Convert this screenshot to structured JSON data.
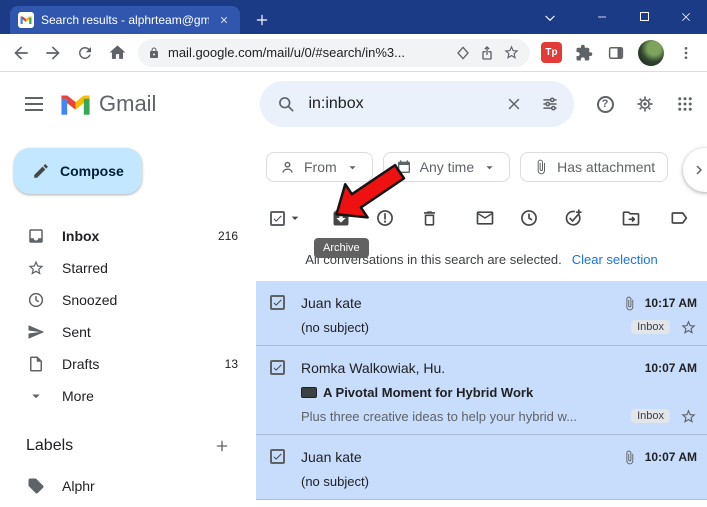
{
  "browser": {
    "tab_title": "Search results - alphrteam@gma",
    "url": "mail.google.com/mail/u/0/#search/in%3...",
    "extension_badge": "Tp"
  },
  "gmail": {
    "logo_text": "Gmail",
    "search_query": "in:inbox",
    "compose_label": "Compose",
    "nav": [
      {
        "label": "Inbox",
        "count": "216"
      },
      {
        "label": "Starred",
        "count": ""
      },
      {
        "label": "Snoozed",
        "count": ""
      },
      {
        "label": "Sent",
        "count": ""
      },
      {
        "label": "Drafts",
        "count": "13"
      },
      {
        "label": "More",
        "count": ""
      }
    ],
    "labels_header": "Labels",
    "label_items": [
      {
        "name": "Alphr"
      }
    ],
    "chips": {
      "from": "From",
      "any_time": "Any time",
      "has_attachment": "Has attachment"
    },
    "tooltip_archive": "Archive",
    "banner": {
      "text": "All conversations in this search are selected.",
      "action": "Clear selection"
    },
    "emails": [
      {
        "sender": "Juan kate",
        "subject": "(no subject)",
        "time": "10:17 AM",
        "badge": "Inbox"
      },
      {
        "sender": "Romka Walkowiak, Hu.",
        "subject": "A Pivotal Moment for Hybrid Work",
        "snippet": "Plus three creative ideas to help your hybrid w...",
        "time": "10:07 AM",
        "badge": "Inbox"
      },
      {
        "sender": "Juan kate",
        "subject": "(no subject)",
        "time": "10:07 AM",
        "badge": ""
      }
    ]
  },
  "colors": {
    "titlebar": "#1b3b87",
    "accent_blue": "#1a73e8",
    "selected_row": "#c8ddfb",
    "compose_bg": "#c2e7ff",
    "arrow_red": "#ee1111"
  }
}
